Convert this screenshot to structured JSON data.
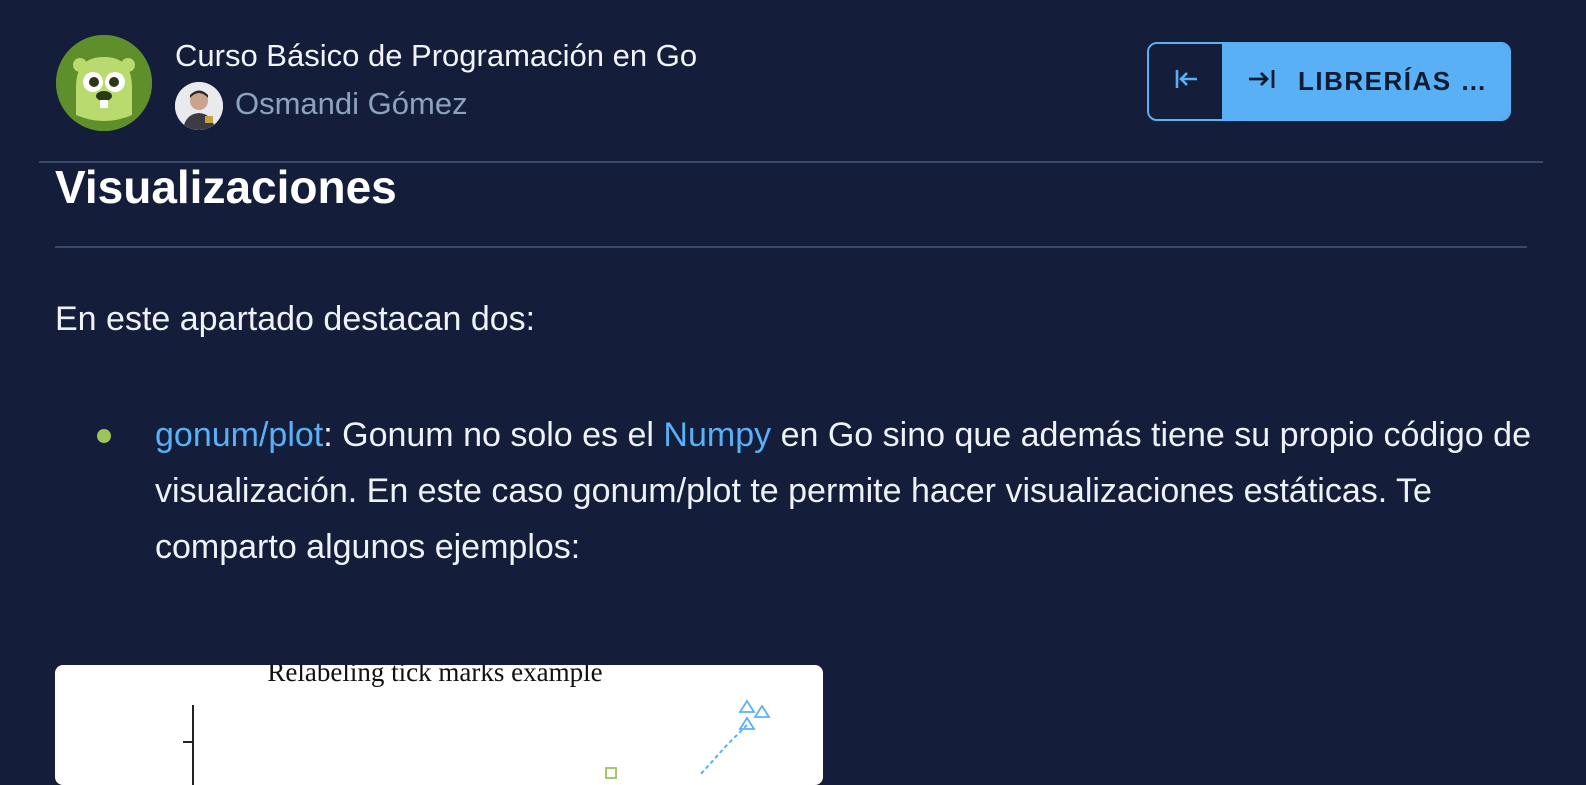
{
  "header": {
    "course_title": "Curso Básico de Programación en Go",
    "author_name": "Osmandi Gómez",
    "logo_icon": "gopher-icon",
    "nav": {
      "prev_icon": "arrow-left-to-line-icon",
      "next_icon": "arrow-right-to-line-icon",
      "next_label": "LIBRERÍAS …"
    }
  },
  "content": {
    "section_title": "Visualizaciones",
    "intro": "En este apartado destacan dos:",
    "bullets": [
      {
        "link_text": "gonum/plot",
        "text_part1": ": Gonum no solo es el ",
        "inline_link": "Numpy",
        "text_part2": " en Go sino que además tiene su propio código de visualización. En este caso gonum/plot te permite hacer visualizaciones estáticas. Te comparto algunos ejemplos:"
      }
    ]
  },
  "chart_data": {
    "type": "scatter",
    "title": "Relabeling tick marks example",
    "xlabel": "",
    "ylabel": "",
    "series": []
  },
  "colors": {
    "background": "#141e3a",
    "accent": "#5ab0f5",
    "bullet": "#9cc45a",
    "logo_green": "#5f8f2a"
  }
}
